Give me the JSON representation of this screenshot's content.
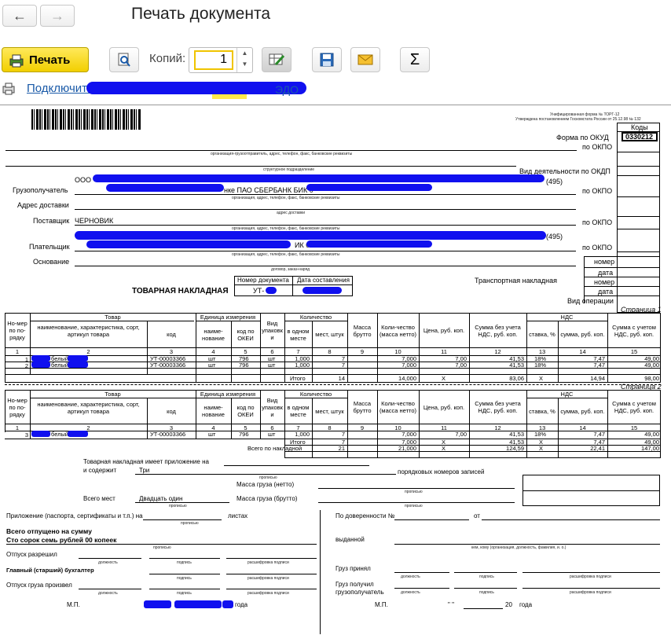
{
  "toolbar": {
    "back": "🡐",
    "forward": "🡒",
    "title": "Печать документа",
    "print_label": "Печать",
    "copies_label": "Копий:",
    "copies_value": "1",
    "connect_link": "Подключить",
    "connect_suffix": "ЭДО"
  },
  "doc": {
    "unified_form": "Унифицированная форма № ТОРГ-12",
    "approved": "Утверждена постановлением Госкомстата России от 25.12.98 № 132",
    "codes_header": "Коды",
    "okud_label": "Форма по ОКУД",
    "okud_value": "0330212",
    "okpo_label": "по ОКПО",
    "okdp_label": "Вид деятельности по ОКДП",
    "org_caption": "организация-грузоотправитель, адрес, телефон, факс, банковские реквизиты",
    "struct_caption": "структурное подразделение",
    "consignee_label": "Грузополучатель",
    "consignee_text": "ООО",
    "consignee_bank": "нке ПАО СБЕРБАНК БИК 0",
    "phone_code": "(495)",
    "org_caption2": "организация, адрес, телефон, факс, банковские реквизиты",
    "delivery_label": "Адрес доставки",
    "delivery_caption": "адрес доставки",
    "supplier_label": "Поставщик",
    "supplier_value": "ЧЕРНОВИК",
    "org_caption3": "организация, адрес, телефон, факс, банковские реквизиты",
    "payer_label": "Плательщик",
    "payer_bik": "ИК 0",
    "payer_phone": "(495)",
    "org_caption4": "организация, адрес, телефон, факс, банковские реквизиты",
    "basis_label": "Основание",
    "basis_caption": "договор, заказ-наряд",
    "number_label": "номер",
    "date_label": "дата",
    "transport_label": "Транспортная накладная",
    "op_type_label": "Вид операции",
    "doc_number_header": "Номер документа",
    "doc_date_header": "Дата составления",
    "doc_number_value": "УТ-",
    "invoice_title": "ТОВАРНАЯ НАКЛАДНАЯ",
    "page1": "Страница 1",
    "page2": "Страница 2"
  },
  "table": {
    "headers": {
      "num": "Но-мер по по-рядку",
      "goods": "Товар",
      "goods_name": "наименование, характеристика, сорт, артикул товара",
      "code": "код",
      "unit": "Единица измерения",
      "unit_name": "наиме-нование",
      "unit_okei": "код по ОКЕИ",
      "pack": "Вид упаковк и",
      "qty": "Количество",
      "qty_one": "в одном месте",
      "qty_places": "мест, штук",
      "mass_gross": "Масса брутто",
      "qty_net": "Коли-чество (масса нетто)",
      "price": "Цена, руб. коп.",
      "sum_novat": "Сумма без учета НДС, руб. коп.",
      "vat": "НДС",
      "vat_rate": "ставка, %",
      "vat_sum": "сумма, руб. коп.",
      "sum_vat": "Сумма с учетом НДС, руб. коп."
    },
    "col_numbers": [
      "1",
      "2",
      "3",
      "4",
      "5",
      "6",
      "7",
      "8",
      "9",
      "10",
      "11",
      "12",
      "13",
      "14",
      "15"
    ],
    "rows": [
      {
        "n": "1",
        "name": "белый",
        "code": "УТ-00003366",
        "unit": "шт",
        "okei": "796",
        "pack": "шт",
        "one": "1,000",
        "places": "7",
        "net": "7,000",
        "price": "7,00",
        "sum": "41,53",
        "rate": "18%",
        "vat": "7,47",
        "total": "49,00"
      },
      {
        "n": "2",
        "name": "белый",
        "code": "УТ-00003366",
        "unit": "шт",
        "okei": "796",
        "pack": "шт",
        "one": "1,000",
        "places": "7",
        "net": "7,000",
        "price": "7,00",
        "sum": "41,53",
        "rate": "18%",
        "vat": "7,47",
        "total": "49,00"
      },
      {
        "n": "3",
        "name": "белый",
        "code": "УТ-00003366",
        "unit": "шт",
        "okei": "796",
        "pack": "шт",
        "one": "1,000",
        "places": "7",
        "net": "7,000",
        "price": "7,00",
        "sum": "41,53",
        "rate": "18%",
        "vat": "7,47",
        "total": "49,00"
      }
    ],
    "totals_p1": {
      "label": "Итого",
      "places": "14",
      "net": "14,000",
      "price": "X",
      "sum": "83,06",
      "rate": "X",
      "vat": "14,94",
      "total": "98,00"
    },
    "totals_p2": {
      "label": "Итого",
      "places": "7",
      "net": "7,000",
      "price": "X",
      "sum": "41,53",
      "rate": "X",
      "vat": "7,47",
      "total": "49,00"
    },
    "grand_total": {
      "label": "Всего по накладной",
      "places": "21",
      "net": "21,000",
      "price": "X",
      "sum": "124,59",
      "rate": "X",
      "vat": "22,41",
      "total": "147,00"
    }
  },
  "footer": {
    "appendix": "Товарная накладная имеет приложение на",
    "contains": "и содержит",
    "contains_value": "Три",
    "records": "порядковых номеров записей",
    "in_words": "прописью",
    "mass_net": "Масса груза (нетто)",
    "mass_gross": "Масса груза (брутто)",
    "places_total": "Всего мест",
    "places_value": "Двадцать один",
    "attachment": "Приложение (паспорта, сертификаты и т.п.) на",
    "sheets": "листах",
    "released_total": "Всего отпущено  на сумму",
    "released_value": "Сто сорок семь рублей 00 копеек",
    "release_allowed": "Отпуск разрешил",
    "chief_accountant": "Главный (старший) бухгалтер",
    "released_by": "Отпуск груза произвел",
    "position": "должность",
    "signature": "подпись",
    "decoding": "расшифровка подписи",
    "mp": "М.П.",
    "year": "года",
    "proxy": "По доверенности №",
    "from": "от",
    "issued": "выданной",
    "issued_caption": "кем, кому (организация, должность, фамилия, и. о.)",
    "cargo_accepted": "Груз принял",
    "cargo_received": "Груз получил грузополучатель",
    "date_quote": "\"     \"",
    "year_prefix": "20"
  }
}
